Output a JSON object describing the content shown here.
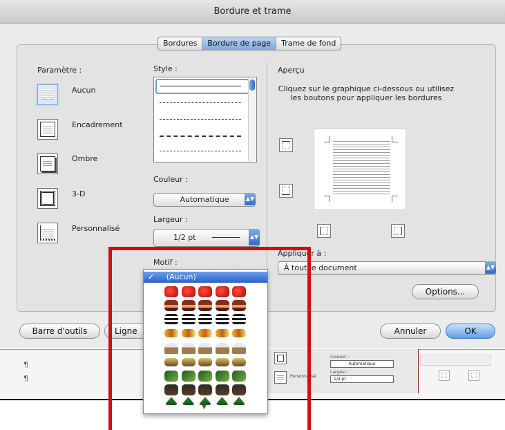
{
  "window": {
    "title": "Bordure et trame"
  },
  "tabs": [
    {
      "label": "Bordures"
    },
    {
      "label": "Bordure de page"
    },
    {
      "label": "Trame de fond"
    }
  ],
  "settings": {
    "heading": "Paramètre :",
    "items": [
      {
        "label": "Aucun",
        "icon": "none-icon"
      },
      {
        "label": "Encadrement",
        "icon": "box-icon"
      },
      {
        "label": "Ombre",
        "icon": "shadow-icon"
      },
      {
        "label": "3-D",
        "icon": "3d-icon"
      },
      {
        "label": "Personnalisé",
        "icon": "custom-icon"
      }
    ]
  },
  "style": {
    "heading": "Style :"
  },
  "color": {
    "heading": "Couleur :",
    "value": "Automatique"
  },
  "width": {
    "heading": "Largeur :",
    "value": "1/2 pt"
  },
  "art": {
    "heading": "Motif :",
    "selected": "(Aucun)",
    "check": "✓",
    "more_arrow": "▼",
    "rows": [
      "apples",
      "cakes",
      "cake-slices",
      "candy-corn",
      "ice-cream-cones",
      "birds",
      "palm-trees",
      "trees"
    ]
  },
  "preview": {
    "heading": "Aperçu",
    "instructions": "Cliquez sur le graphique ci-dessous ou utilisez les boutons pour appliquer les bordures"
  },
  "apply": {
    "heading": "Appliquer à :",
    "value": "À tout le document"
  },
  "buttons": {
    "options": "Options...",
    "toolbar": "Barre d'outils",
    "lines": "Ligne",
    "cancel": "Annuler",
    "ok": "OK"
  },
  "background_doc": {
    "pilcrow": "¶",
    "mini_color_label": "Couleur :",
    "mini_color_value": "Automatique",
    "mini_width_label": "Largeur :",
    "mini_width_value": "1/4 pt",
    "mini_custom_label": "Personnalisé"
  },
  "colors": {
    "accent": "#3b78d8",
    "annotation": "#d01010"
  }
}
